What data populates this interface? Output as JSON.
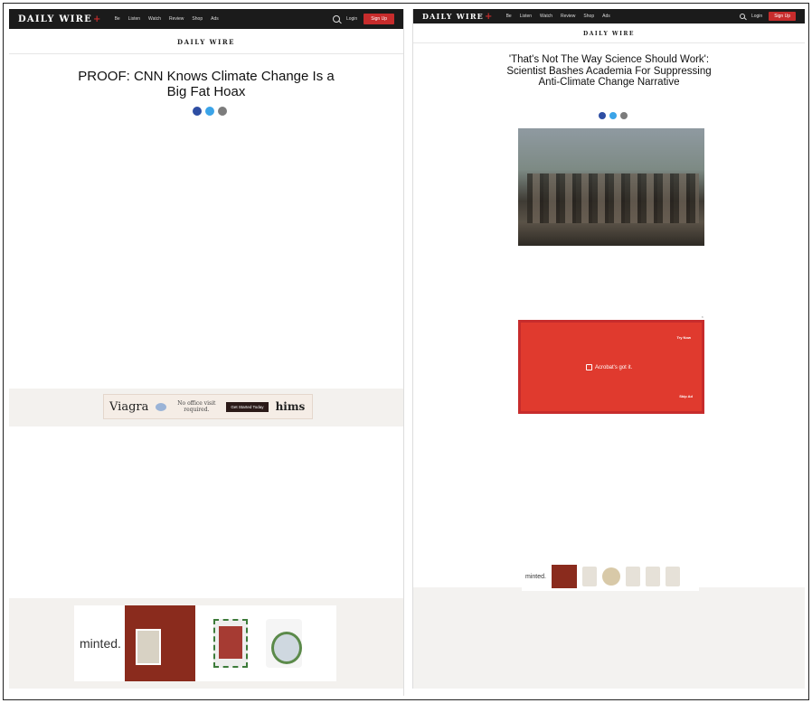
{
  "left_article": {
    "brand": "DAILY WIRE",
    "brand_plus": "+",
    "nav": [
      "Be",
      "Listen",
      "Watch",
      "Review",
      "Shop",
      "Ads"
    ],
    "login": "Login",
    "signup": "Sign Up",
    "masthead": "DAILY WIRE",
    "kicker": "",
    "headline": "PROOF: CNN Knows Climate Change Is a Big Fat Hoax",
    "byline_author": "",
    "byline_date": "",
    "paragraphs": [
      "",
      "",
      "",
      "",
      ""
    ],
    "paragraphs_after_ad": [
      "",
      "",
      ""
    ],
    "viagra_ad": {
      "brand": "Viagra",
      "tagline": "No office visit required.",
      "button": "Get Started Today",
      "partner": "hims"
    },
    "minted_ad": {
      "brand": "minted."
    }
  },
  "right_article": {
    "brand": "DAILY WIRE",
    "brand_plus": "+",
    "nav": [
      "Be",
      "Listen",
      "Watch",
      "Review",
      "Shop",
      "Ads"
    ],
    "login": "Login",
    "signup": "Sign Up",
    "masthead": "DAILY WIRE",
    "kicker": "",
    "headline": "'That's Not The Way Science Should Work': Scientist Bashes Academia For Suppressing Anti-Climate Change Narrative",
    "dek": "",
    "byline_author": "",
    "byline_date": "",
    "hero_credit": "",
    "paragraphs": [
      "",
      ""
    ],
    "acrobat_ad": {
      "cta": "Try Now",
      "message": "Acrobat's got it.",
      "signup": "Skip Ad"
    },
    "paragraphs_after_ad": [
      "",
      "",
      ""
    ],
    "minted_strip": {
      "brand": "minted."
    }
  },
  "colors": {
    "topbar": "#1b1b1b",
    "accent_red": "#c72c2c",
    "share_facebook": "#2e4ea3",
    "share_twitter": "#3ba4e8",
    "share_email": "#7c7c7c"
  }
}
